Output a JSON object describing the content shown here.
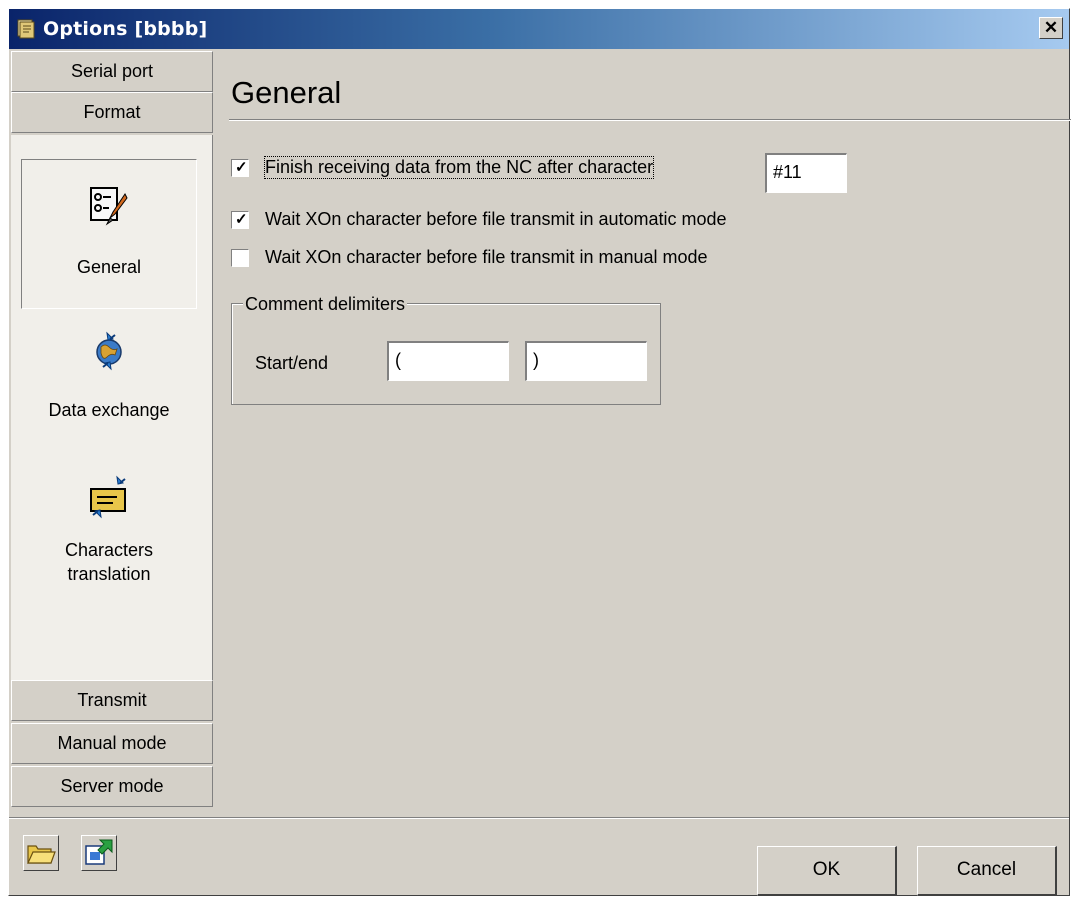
{
  "window": {
    "title": "Options [bbbb]",
    "close_glyph": "✕"
  },
  "nav": {
    "top_categories": [
      "Serial port",
      "Format"
    ],
    "items": [
      {
        "label": "General",
        "icon": "settings-checklist-icon",
        "selected": true
      },
      {
        "label": "Data exchange",
        "icon": "globe-exchange-icon",
        "selected": false
      },
      {
        "label": "Characters\ntranslation",
        "icon": "envelope-translation-icon",
        "selected": false
      }
    ],
    "bottom_categories": [
      "Transmit",
      "Manual mode",
      "Server mode"
    ]
  },
  "main": {
    "heading": "General",
    "options": [
      {
        "label": "Finish receiving data from the NC after character",
        "checked": true,
        "value": "#11"
      },
      {
        "label": "Wait XOn character before file transmit in automatic mode",
        "checked": true
      },
      {
        "label": "Wait XOn character before file transmit in manual mode",
        "checked": false
      }
    ],
    "comment_group": {
      "legend": "Comment delimiters",
      "row_label": "Start/end",
      "start_value": "(",
      "end_value": ")"
    }
  },
  "footer": {
    "open_icon": "open-folder-icon",
    "export_icon": "export-icon",
    "ok_label": "OK",
    "cancel_label": "Cancel"
  },
  "colors": {
    "face": "#d4d0c8",
    "title_start": "#0a246a",
    "title_end": "#a6caf0",
    "panel": "#f1efea"
  }
}
